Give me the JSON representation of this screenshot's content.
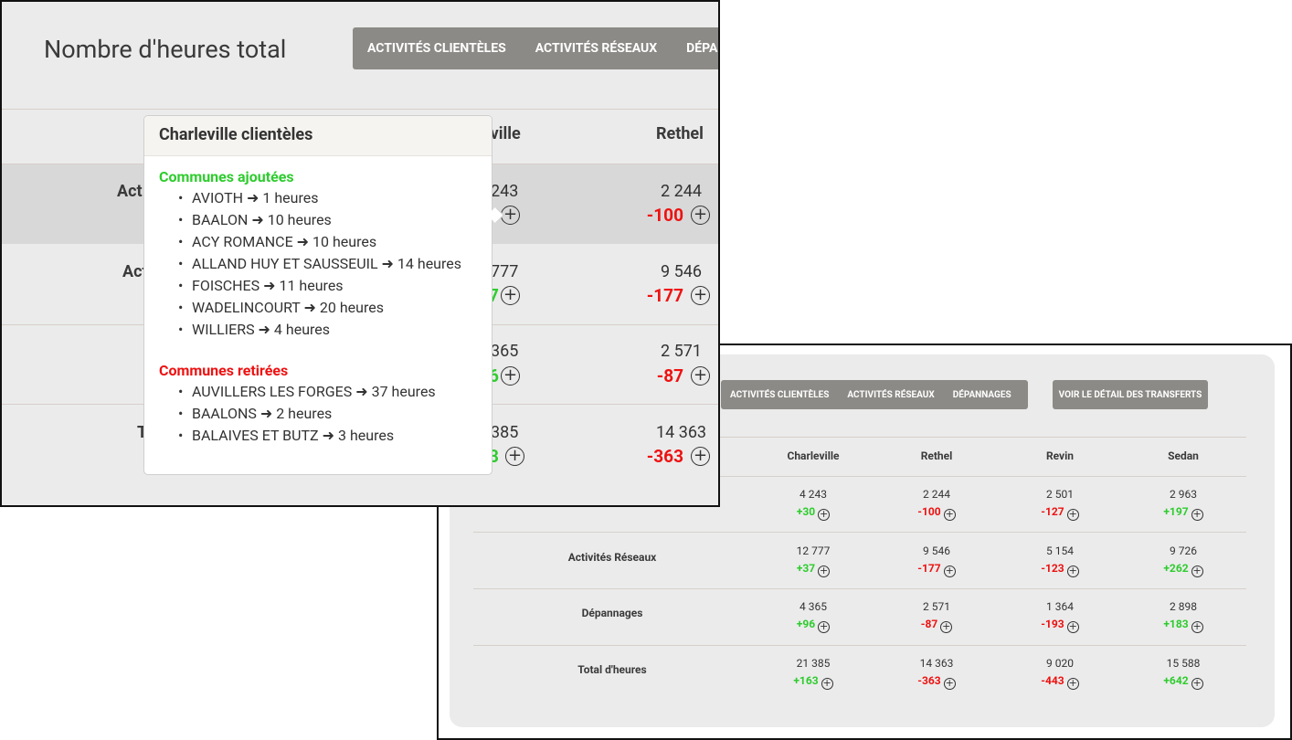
{
  "back": {
    "tabs": [
      "ACTIVITÉS CLIENTÈLES",
      "ACTIVITÉS RÉSEAUX",
      "DÉPANNAGES"
    ],
    "detail_button": "VOIR LE DÉTAIL DES TRANSFERTS",
    "columns": [
      "Charleville",
      "Rethel",
      "Revin",
      "Sedan"
    ],
    "rows": [
      {
        "label": "",
        "cells": [
          {
            "value": "4 243",
            "delta": "+30"
          },
          {
            "value": "2 244",
            "delta": "-100"
          },
          {
            "value": "2 501",
            "delta": "-127"
          },
          {
            "value": "2 963",
            "delta": "+197"
          }
        ]
      },
      {
        "label": "Activités Réseaux",
        "cells": [
          {
            "value": "12 777",
            "delta": "+37"
          },
          {
            "value": "9 546",
            "delta": "-177"
          },
          {
            "value": "5 154",
            "delta": "-123"
          },
          {
            "value": "9 726",
            "delta": "+262"
          }
        ]
      },
      {
        "label": "Dépannages",
        "cells": [
          {
            "value": "4 365",
            "delta": "+96"
          },
          {
            "value": "2 571",
            "delta": "-87"
          },
          {
            "value": "1 364",
            "delta": "-193"
          },
          {
            "value": "2 898",
            "delta": "+183"
          }
        ]
      },
      {
        "label": "Total d'heures",
        "cells": [
          {
            "value": "21 385",
            "delta": "+163"
          },
          {
            "value": "14 363",
            "delta": "-363"
          },
          {
            "value": "9 020",
            "delta": "-443"
          },
          {
            "value": "15 588",
            "delta": "+642"
          }
        ]
      }
    ]
  },
  "front": {
    "title": "Nombre d'heures total",
    "tabs": [
      "ACTIVITÉS CLIENTÈLES",
      "ACTIVITÉS RÉSEAUX",
      "DÉPANNAGES"
    ],
    "col_charleville_partial": "eville",
    "col_rethel": "Rethel",
    "row_labels_partial": [
      "Act",
      "Act",
      "T"
    ],
    "charleville_partial": [
      {
        "value": "243",
        "delta": ""
      },
      {
        "value": "777",
        "delta": "7"
      },
      {
        "value": "365",
        "delta": "6"
      },
      {
        "value": "385",
        "delta": "3"
      }
    ],
    "rethel": [
      {
        "value": "2 244",
        "delta": "-100"
      },
      {
        "value": "9 546",
        "delta": "-177"
      },
      {
        "value": "2 571",
        "delta": "-87"
      },
      {
        "value": "14 363",
        "delta": "-363"
      }
    ],
    "plus_symbol": "+",
    "popover": {
      "title": "Charleville clientèles",
      "added_title": "Communes ajoutées",
      "added": [
        "AVIOTH ➜ 1 heures",
        "BAALON ➜ 10 heures",
        "ACY ROMANCE ➜ 10 heures",
        "ALLAND HUY ET SAUSSEUIL ➜ 14 heures",
        "FOISCHES ➜ 11 heures",
        "WADELINCOURT ➜ 20 heures",
        "WILLIERS ➜ 4 heures"
      ],
      "removed_title": "Communes retirées",
      "removed": [
        "AUVILLERS LES FORGES ➜ 37 heures",
        "BAALONS ➜ 2 heures",
        "BALAIVES ET BUTZ ➜ 3 heures"
      ]
    }
  },
  "colors": {
    "positive": "#2ecc2e",
    "negative": "#ee1111",
    "tab_bg": "#8c8a86",
    "panel_bg": "#ebebeb"
  }
}
